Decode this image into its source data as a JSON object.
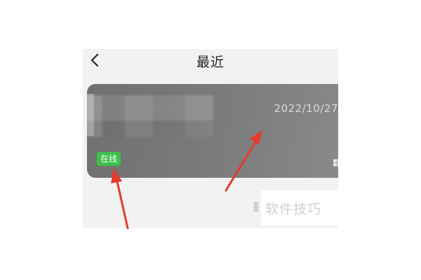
{
  "header": {
    "title": "最近"
  },
  "device_card": {
    "date": "2022/10/27",
    "status": "在线",
    "os_icon": "windows-icon"
  },
  "watermark": {
    "text": "软件技巧"
  },
  "icons": {
    "back": "chevron-left-icon"
  },
  "colors": {
    "status_green": "#3cc04a",
    "card_gray": "#767676",
    "arrow_red": "#e53a2e"
  }
}
